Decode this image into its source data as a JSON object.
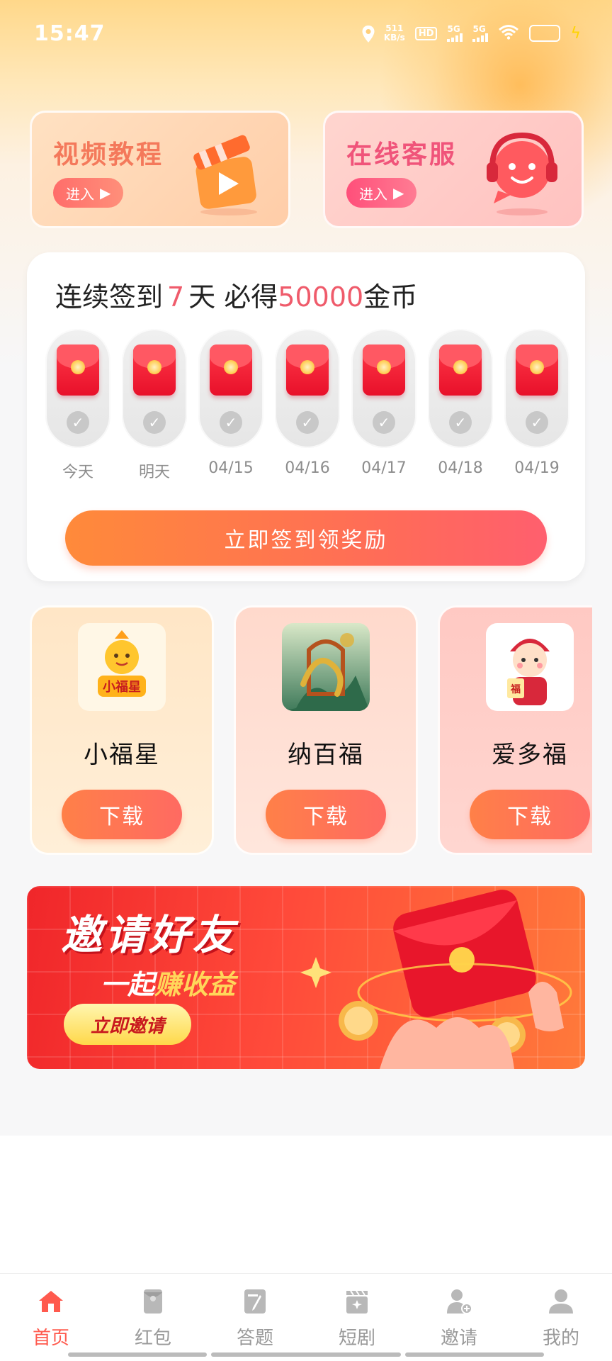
{
  "status_bar": {
    "time": "15:47",
    "net_speed_value": "511",
    "net_speed_unit": "KB/s",
    "hd_label": "HD",
    "signal1": "5G",
    "signal2": "5G",
    "battery_level": 0.5,
    "icons": [
      "location-icon",
      "hd-icon",
      "signal-icon",
      "wifi-icon",
      "battery-icon",
      "charging-icon"
    ]
  },
  "entries": [
    {
      "title": "视频教程",
      "enter_label": "进入",
      "icon": "video-tutorial-icon"
    },
    {
      "title": "在线客服",
      "enter_label": "进入",
      "icon": "customer-service-icon"
    }
  ],
  "signin": {
    "headline_prefix": "连续签到",
    "headline_days": "7",
    "headline_mid": "天 必得",
    "headline_coins": "50000",
    "headline_suffix": "金币",
    "days": [
      {
        "label": "今天"
      },
      {
        "label": "明天"
      },
      {
        "label": "04/15"
      },
      {
        "label": "04/16"
      },
      {
        "label": "04/17"
      },
      {
        "label": "04/18"
      },
      {
        "label": "04/19"
      }
    ],
    "button_label": "立即签到领奖励"
  },
  "apps": [
    {
      "name": "小福星",
      "logo_text": "小福星",
      "download_label": "下载"
    },
    {
      "name": "纳百福",
      "download_label": "下载"
    },
    {
      "name": "爱多福",
      "logo_text": "福",
      "download_label": "下载"
    }
  ],
  "banner": {
    "title": "邀请好友",
    "subtitle_prefix": "一起",
    "subtitle_highlight": "赚收益",
    "button_label": "立即邀请"
  },
  "tabbar": {
    "items": [
      {
        "label": "首页",
        "icon": "home-icon",
        "active": true
      },
      {
        "label": "红包",
        "icon": "red-packet-icon",
        "active": false
      },
      {
        "label": "答题",
        "icon": "quiz-icon",
        "active": false
      },
      {
        "label": "短剧",
        "icon": "short-drama-icon",
        "active": false
      },
      {
        "label": "邀请",
        "icon": "invite-icon",
        "active": false
      },
      {
        "label": "我的",
        "icon": "profile-icon",
        "active": false
      }
    ],
    "active_color": "#ff5a4e",
    "inactive_color": "#9a9a9a"
  },
  "colors": {
    "accent": "#ef5b6b",
    "button_orange": "#ff8a3a"
  }
}
